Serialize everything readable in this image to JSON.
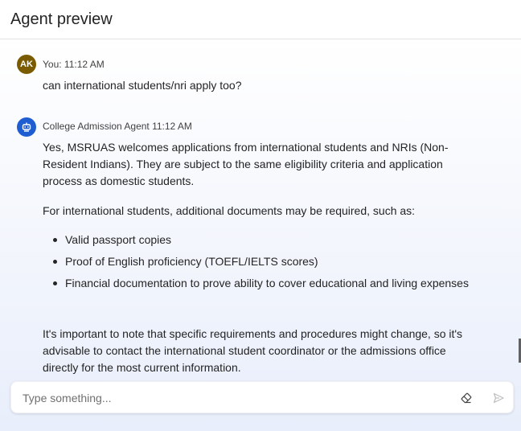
{
  "header": {
    "title": "Agent preview"
  },
  "messages": [
    {
      "avatar_initials": "AK",
      "meta": "You: 11:12 AM",
      "text": "can international students/nri apply too?"
    },
    {
      "avatar_icon": "bot-icon",
      "meta": "College Admission Agent 11:12 AM",
      "para1": "Yes, MSRUAS welcomes applications from international students and NRIs (Non-Resident Indians). They are subject to the same eligibility criteria and application process as domestic students.",
      "para2": "For international students, additional documents may be required, such as:",
      "bullets": [
        "Valid passport copies",
        "Proof of English proficiency (TOEFL/IELTS scores)",
        "Financial documentation to prove ability to cover educational and living expenses"
      ],
      "para3": "It's important to note that specific requirements and procedures might change, so it's advisable to contact the international student coordinator or the admissions office directly for the most current information."
    }
  ],
  "composer": {
    "placeholder": "Type something...",
    "clear_icon": "eraser-icon",
    "send_icon": "send-icon"
  },
  "colors": {
    "accent": "#0f6cbd",
    "user_avatar": "#7a5b00",
    "bot_avatar": "#1f5ed1"
  }
}
